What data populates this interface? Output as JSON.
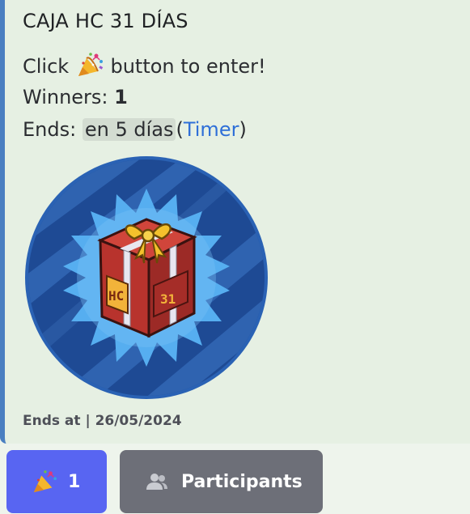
{
  "embed": {
    "title": "CAJA HC 31 DÍAS",
    "click_prefix": "Click",
    "click_suffix": "button to enter!",
    "winners_label": "Winners:",
    "winners_count": "1",
    "ends_label": "Ends:",
    "ends_relative": "en 5 días",
    "paren_open": "(",
    "timer_link": "Timer",
    "paren_close": ")",
    "image": {
      "box_text_left": "HC",
      "box_text_right": "31"
    },
    "footer": "Ends at | 26/05/2024"
  },
  "buttons": {
    "enter_count": "1",
    "participants_label": "Participants"
  },
  "colors": {
    "accent_bar": "#4a7fc1",
    "enter_button": "#5865f2",
    "participants_button": "#6d6f78",
    "link": "#2e6fd8"
  },
  "icons": {
    "party": "party-popper-icon",
    "participants": "users-icon"
  }
}
